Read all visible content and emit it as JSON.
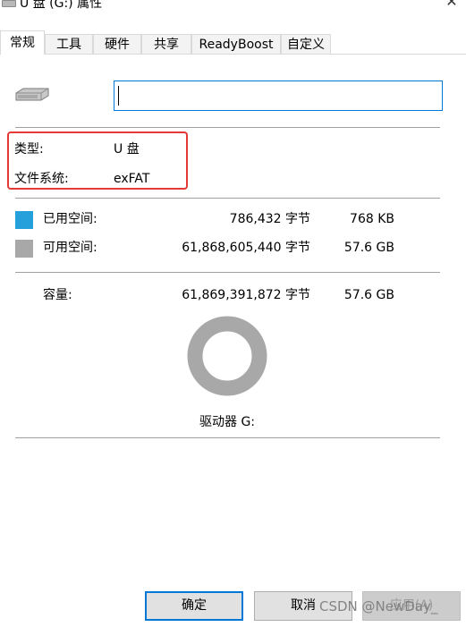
{
  "window": {
    "title": "U 盘 (G:) 属性"
  },
  "tabs": [
    {
      "label": "常规",
      "active": true
    },
    {
      "label": "工具"
    },
    {
      "label": "硬件"
    },
    {
      "label": "共享"
    },
    {
      "label": "ReadyBoost"
    },
    {
      "label": "自定义"
    }
  ],
  "general": {
    "name_input_value": "",
    "type_label": "类型:",
    "type_value": "U 盘",
    "fs_label": "文件系统:",
    "fs_value": "exFAT",
    "used": {
      "label": "已用空间:",
      "bytes": "786,432 字节",
      "size": "768 KB",
      "color": "#26a0da"
    },
    "free": {
      "label": "可用空间:",
      "bytes": "61,868,605,440 字节",
      "size": "57.6 GB",
      "color": "#a8a8a8"
    },
    "capacity": {
      "label": "容量:",
      "bytes": "61,869,391,872 字节",
      "size": "57.6 GB"
    },
    "usage_fraction": 1.27e-05,
    "drive_label": "驱动器 G:"
  },
  "buttons": {
    "ok": "确定",
    "cancel": "取消",
    "apply": "应用(A)"
  },
  "watermark": "CSDN @NewDay_"
}
